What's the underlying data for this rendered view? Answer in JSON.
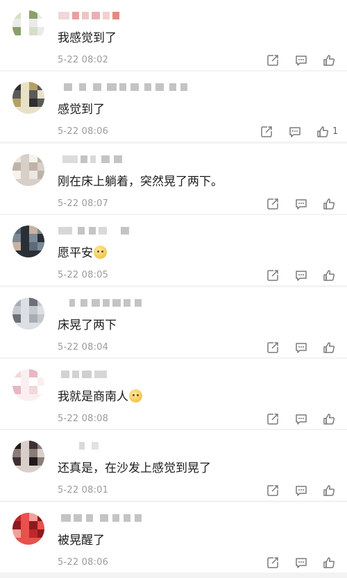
{
  "comments": [
    {
      "text": "我感觉到了",
      "time": "5-22 08:02",
      "likes": "",
      "avatar": [
        "#d6dfc6",
        "#ffffff",
        "#8aa06a",
        "#eaeaea"
      ]
    },
    {
      "text": "感觉到了",
      "time": "5-22 08:06",
      "likes": "1",
      "avatar": [
        "#2f2f2f",
        "#e8e1c8",
        "#b3a064",
        "#5a5a5a"
      ]
    },
    {
      "text": "刚在床上躺着，突然晃了两下。",
      "time": "5-22 08:07",
      "likes": "",
      "avatar": [
        "#ece7e2",
        "#d7cfc8",
        "#f6f2ee",
        "#bfb3a9"
      ]
    },
    {
      "text": "愿平安",
      "emoji": true,
      "time": "5-22 08:05",
      "likes": "",
      "avatar": [
        "#5a6a78",
        "#2a2f36",
        "#c9b2a1",
        "#7a8a96"
      ]
    },
    {
      "text": "床晃了两下",
      "time": "5-22 08:04",
      "likes": "",
      "avatar": [
        "#a9adb3",
        "#dcdfe3",
        "#6b7077",
        "#c5c8cd"
      ]
    },
    {
      "text": "我就是商南人",
      "emoji": true,
      "time": "5-22 08:08",
      "likes": "",
      "avatar": [
        "#f2d7dc",
        "#fbeef0",
        "#e6b8c2",
        "#ffffff"
      ]
    },
    {
      "text": "还真是，在沙发上感觉到晃了",
      "time": "5-22 08:01",
      "likes": "",
      "avatar": [
        "#1f1a1c",
        "#d9cfc9",
        "#3c3033",
        "#8c7c78"
      ]
    },
    {
      "text": "被晃醒了",
      "time": "5-22 08:06",
      "likes": "",
      "avatar": [
        "#c0262b",
        "#e8514c",
        "#f2a09a",
        "#8e1a1d"
      ]
    }
  ]
}
